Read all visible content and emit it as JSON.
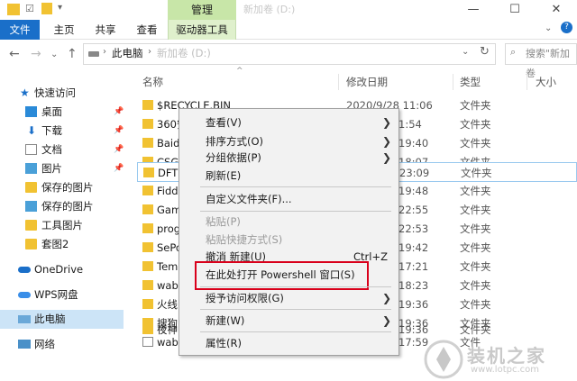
{
  "titlebar": {
    "manage_label": "管理",
    "window_title": "新加卷 (D:)",
    "minimize": "—",
    "maximize": "☐",
    "close": "✕"
  },
  "ribbon": {
    "tabs": [
      "文件",
      "主页",
      "共享",
      "查看"
    ],
    "drive_tools": "驱动器工具"
  },
  "address": {
    "path_pc": "此电脑",
    "path_drive": "新加卷 (D:)",
    "search_placeholder": "搜索\"新加卷"
  },
  "sidebar": {
    "items": [
      "快速访问",
      "桌面",
      "下载",
      "文档",
      "图片",
      "保存的图片",
      "保存的图片",
      "工具图片",
      "套图2",
      "OneDrive",
      "WPS网盘",
      "此电脑",
      "网络"
    ]
  },
  "columns": {
    "name": "名称",
    "date": "修改日期",
    "type": "类型",
    "size": "大小"
  },
  "files": [
    {
      "name": "$RECYCLE.BIN",
      "date": "2020/9/28 11:06",
      "type": "文件夹"
    },
    {
      "name": "360安",
      "date": "1:54",
      "type": "文件夹"
    },
    {
      "name": "Baidu",
      "date": "19:40",
      "type": "文件夹"
    },
    {
      "name": "CSGO",
      "date": "18:07",
      "type": "文件夹"
    },
    {
      "name": "DFTK",
      "date": "23:09",
      "type": "文件夹"
    },
    {
      "name": "Fiddl",
      "date": "19:48",
      "type": "文件夹"
    },
    {
      "name": "Gam",
      "date": "22:55",
      "type": "文件夹"
    },
    {
      "name": "prog",
      "date": "22:53",
      "type": "文件夹"
    },
    {
      "name": "SePo",
      "date": "19:42",
      "type": "文件夹"
    },
    {
      "name": "Temp",
      "date": "17:21",
      "type": "文件夹"
    },
    {
      "name": "waby",
      "date": "18:23",
      "type": "文件夹"
    },
    {
      "name": "火线",
      "date": "19:36",
      "type": "文件夹"
    },
    {
      "name": "搜狗",
      "date": "19:36",
      "type": "文件夹"
    },
    {
      "name": "夜神",
      "date": "19:36",
      "type": "文件夹"
    },
    {
      "name": "waby",
      "date": "17:59",
      "type": "文件"
    }
  ],
  "context_menu": {
    "view": "查看(V)",
    "sort": "排序方式(O)",
    "group": "分组依据(P)",
    "refresh": "刷新(E)",
    "customize": "自定义文件夹(F)...",
    "paste": "粘贴(P)",
    "paste_shortcut": "粘贴快捷方式(S)",
    "undo": "撤消 新建(U)",
    "undo_shortcut": "Ctrl+Z",
    "powershell": "在此处打开 Powershell 窗口(S)",
    "grant": "授予访问权限(G)",
    "new": "新建(W)",
    "properties": "属性(R)"
  },
  "watermark": {
    "text": "装机之家",
    "url": "www.lotpc.com"
  }
}
